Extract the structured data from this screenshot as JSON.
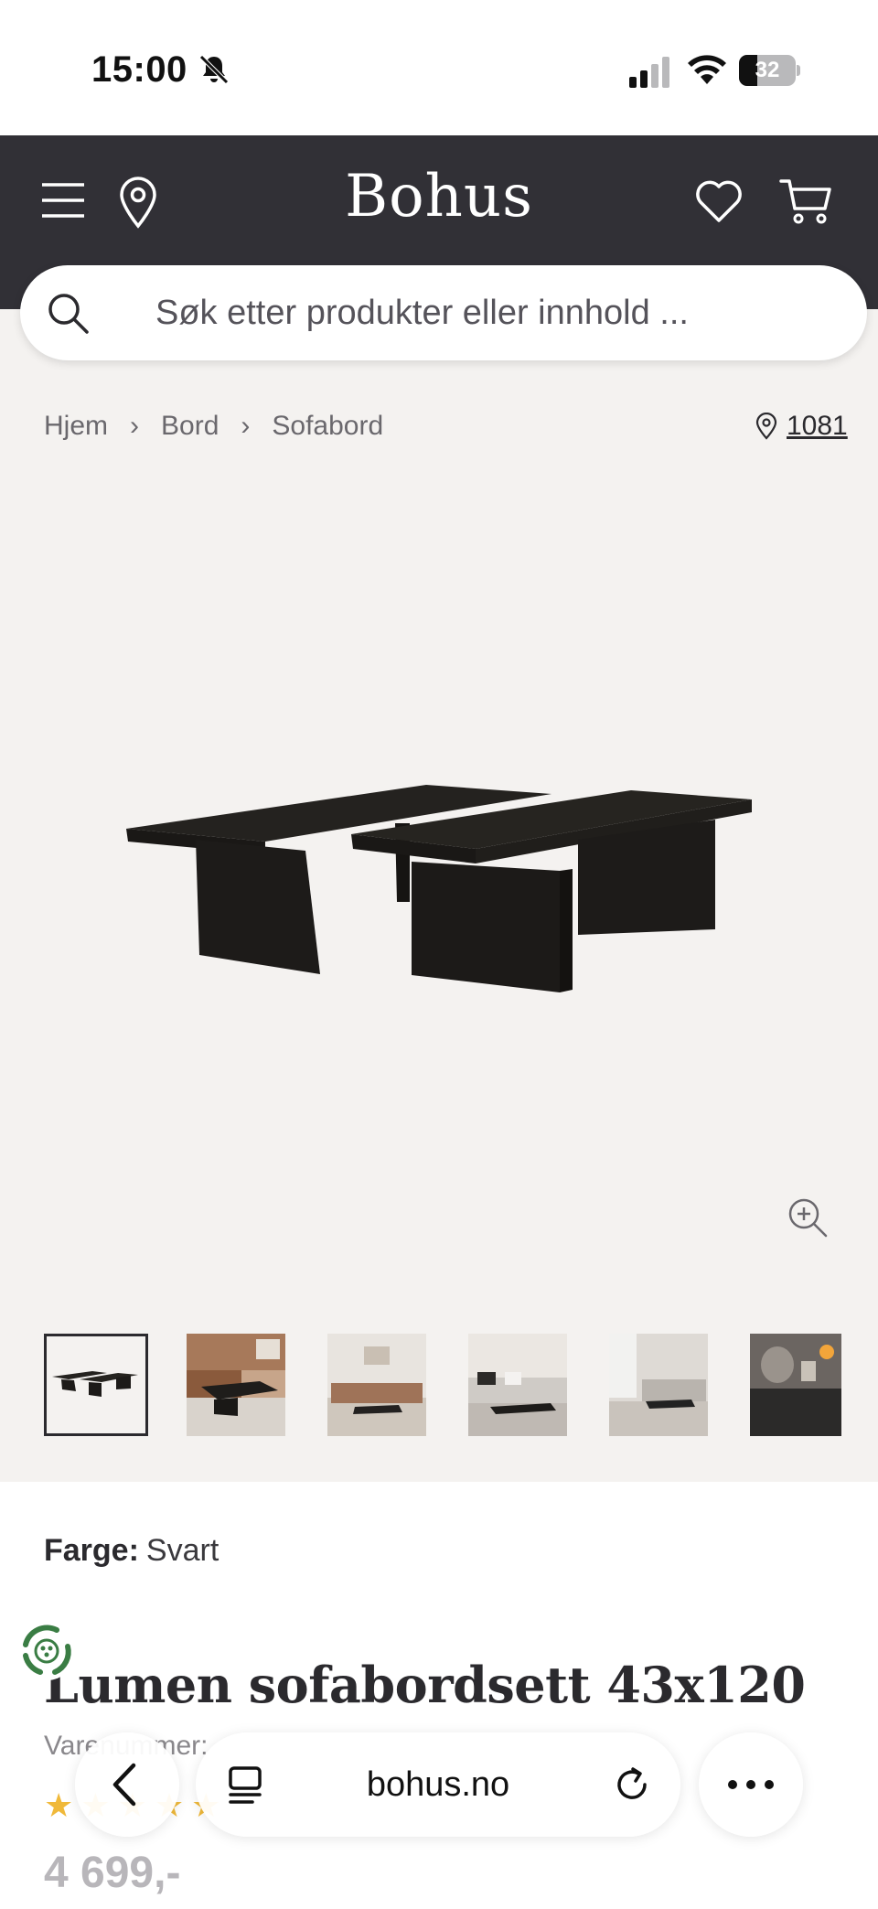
{
  "status_bar": {
    "time": "15:00",
    "battery": "32",
    "battery_level": 0.32,
    "icons": [
      "bell-muted-icon",
      "cellular-signal-icon",
      "wifi-icon",
      "battery-icon"
    ]
  },
  "header": {
    "logo": "Bohus",
    "icons": [
      "hamburger-menu-icon",
      "location-pin-icon",
      "heart-icon",
      "cart-icon"
    ],
    "background_color": "#313036"
  },
  "search": {
    "placeholder": "Søk etter produkter eller innhold ..."
  },
  "breadcrumb": {
    "items": [
      "Hjem",
      "Bord",
      "Sofabord"
    ]
  },
  "store": {
    "code": "1081"
  },
  "gallery": {
    "thumbnail_count": 6,
    "active_index": 0
  },
  "product": {
    "color_label": "Farge:",
    "color_value": "Svart",
    "title": "Lumen sofabordsett 43x120",
    "article_number_label": "Varenummer:",
    "rating_stars": 5,
    "price": "4 699,-"
  },
  "browser_bar": {
    "domain": "bohus.no",
    "icons": [
      "back-chevron-icon",
      "tabs-icon",
      "reload-icon",
      "more-icon"
    ]
  },
  "colors": {
    "page_background": "#f4f2f0",
    "star": "#f0b93a"
  }
}
